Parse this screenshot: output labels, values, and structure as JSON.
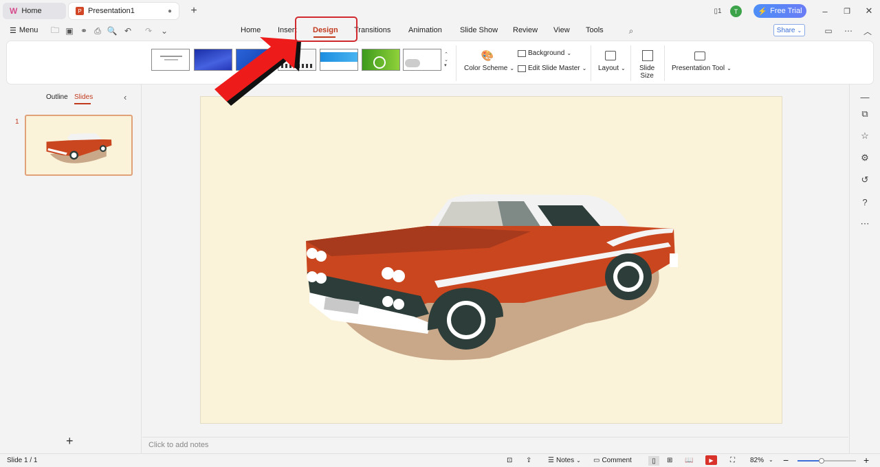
{
  "titlebar": {
    "home_tab": "Home",
    "doc_tab": "Presentation1",
    "free_trial": "Free Trial",
    "avatar_initial": "T"
  },
  "menu": {
    "menu_label": "Menu",
    "tabs": [
      "Home",
      "Insert",
      "Design",
      "Transitions",
      "Animation",
      "Slide Show",
      "Review",
      "View",
      "Tools"
    ],
    "active_tab": "Design",
    "share": "Share"
  },
  "ribbon": {
    "color_scheme": "Color Scheme",
    "background": "Background",
    "edit_slide_master": "Edit Slide Master",
    "layout": "Layout",
    "slide_size_line1": "Slide",
    "slide_size_line2": "Size",
    "presentation_tool": "Presentation Tool",
    "themes": [
      "blank-white",
      "blue-gradient",
      "blue-diagonal",
      "city-silhouette",
      "blue-banner",
      "green-clock",
      "grey-clouds"
    ]
  },
  "panel": {
    "outline_tab": "Outline",
    "slides_tab": "Slides",
    "slide_number": "1"
  },
  "notes": {
    "placeholder": "Click to add notes"
  },
  "statusbar": {
    "slide_counter": "Slide 1 / 1",
    "notes": "Notes",
    "comment": "Comment",
    "zoom": "82%"
  },
  "colors": {
    "accent": "#c23a1d",
    "highlight": "#d0282c",
    "slide_bg": "#fbf3d9",
    "car_body": "#c9461f"
  }
}
